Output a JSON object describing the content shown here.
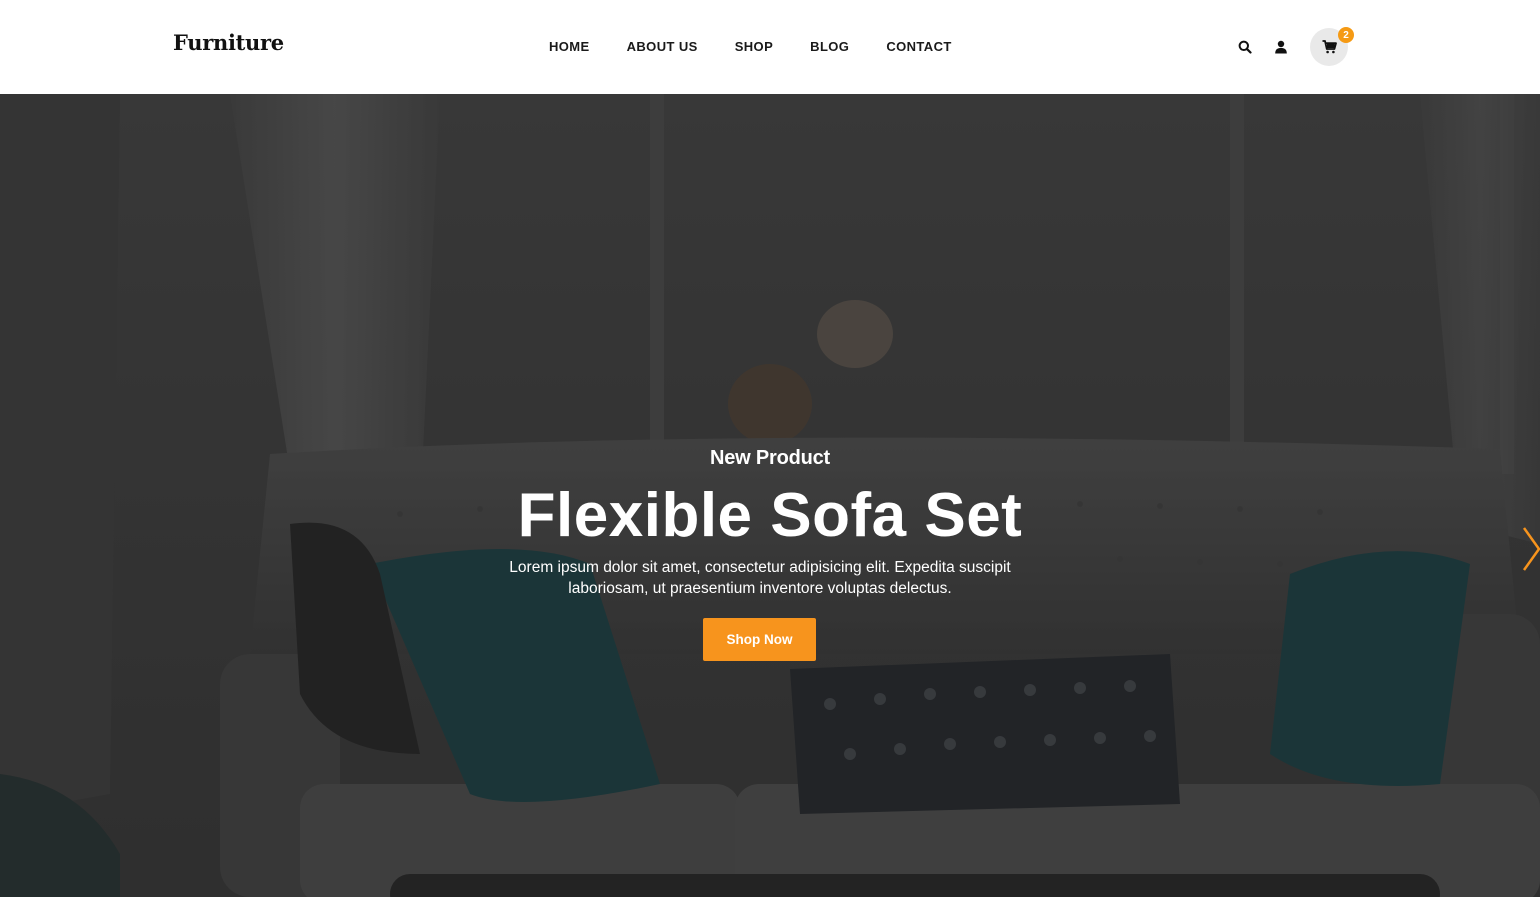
{
  "header": {
    "logo": "Furniture",
    "nav": [
      "HOME",
      "ABOUT US",
      "SHOP",
      "BLOG",
      "CONTACT"
    ],
    "cart_count": "2",
    "accent_color": "#f7941d"
  },
  "hero": {
    "subtitle": "New Product",
    "title": "Flexible Sofa Set",
    "description": "Lorem ipsum dolor sit amet, consectetur adipisicing elit. Expedita suscipit laboriosam, ut praesentium inventore voluptas delectus.",
    "button": "Shop Now",
    "next_icon": "chevron-right-icon"
  }
}
